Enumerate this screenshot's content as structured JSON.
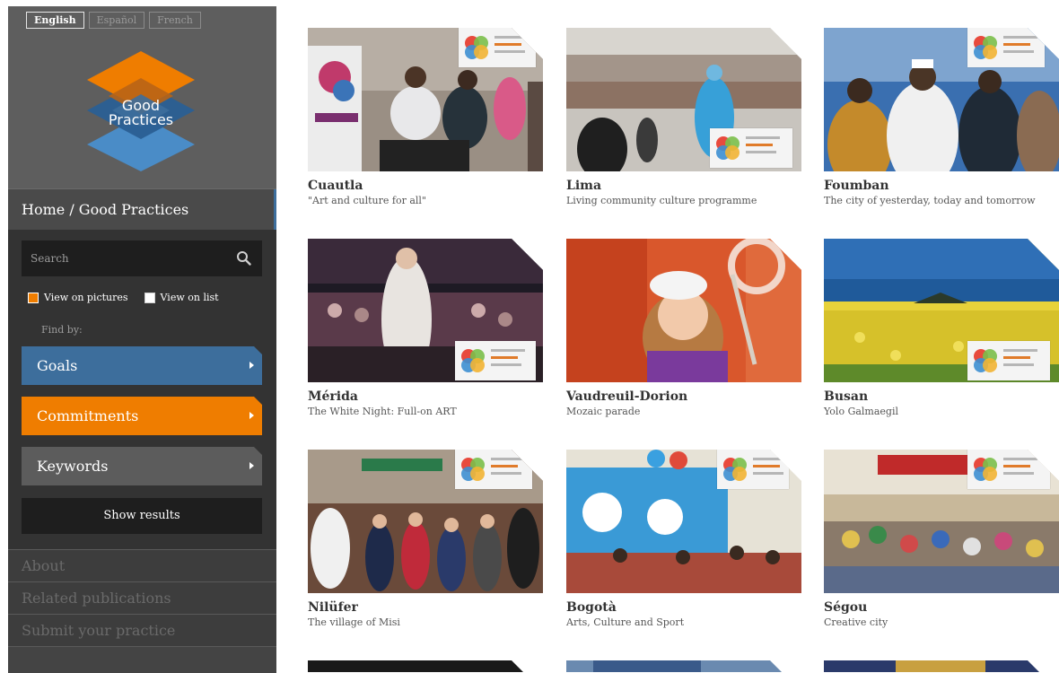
{
  "languages": [
    "English",
    "Español",
    "French"
  ],
  "logo": {
    "line1": "Good",
    "line2": "Practices"
  },
  "breadcrumb": "Home / Good Practices",
  "search": {
    "placeholder": "Search"
  },
  "view_options": {
    "pictures": "View on pictures",
    "list": "View on list",
    "pictures_checked": true,
    "list_checked": false
  },
  "find_by": "Find by:",
  "filters": {
    "goals": "Goals",
    "commitments": "Commitments",
    "keywords": "Keywords"
  },
  "show_results": "Show results",
  "links": [
    "About",
    "Related publications",
    "Submit your practice"
  ],
  "colors": {
    "goals": "#3d6e9c",
    "commitments": "#ef7d00",
    "keywords": "#5c5c5c"
  },
  "cards": [
    {
      "city": "Cuautla",
      "subtitle": "\"Art and culture for all\""
    },
    {
      "city": "Lima",
      "subtitle": "Living community culture programme"
    },
    {
      "city": "Foumban",
      "subtitle": "The city of yesterday, today and tomorrow"
    },
    {
      "city": "Mérida",
      "subtitle": "The White Night: Full-on ART"
    },
    {
      "city": "Vaudreuil-Dorion",
      "subtitle": "Mozaic parade"
    },
    {
      "city": "Busan",
      "subtitle": "Yolo Galmaegil"
    },
    {
      "city": "Nilüfer",
      "subtitle": "The village of Misi"
    },
    {
      "city": "Bogotà",
      "subtitle": "Arts, Culture and Sport"
    },
    {
      "city": "Ségou",
      "subtitle": "Creative city"
    }
  ]
}
